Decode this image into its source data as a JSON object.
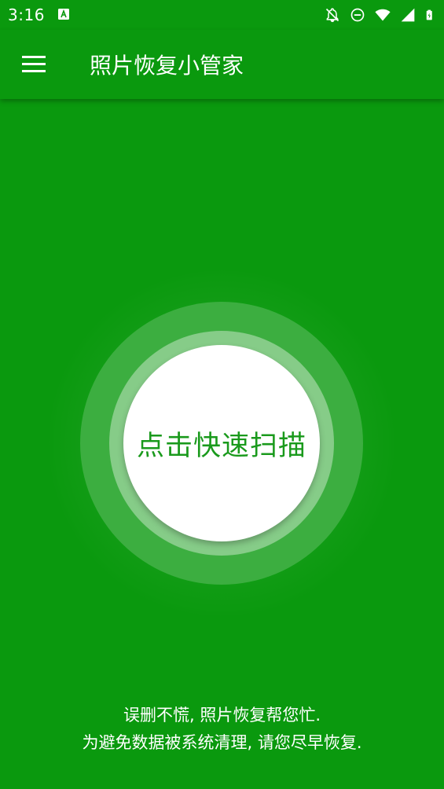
{
  "status_bar": {
    "time": "3:16",
    "icons": [
      "app-a-icon",
      "notifications-off-icon",
      "do-not-disturb-icon",
      "wifi-icon",
      "signal-icon",
      "battery-charging-icon"
    ]
  },
  "app_bar": {
    "title": "照片恢复小管家",
    "menu_icon": "menu-icon"
  },
  "scan": {
    "button_label": "点击快速扫描"
  },
  "tips": {
    "line1": "误删不慌, 照片恢复帮您忙.",
    "line2": "为避免数据被系统清理, 请您尽早恢复."
  },
  "colors": {
    "primary": "#0a990e",
    "outer_ring": "#3cae40",
    "inner_ring": "#86cc88",
    "button_text": "#1a9a1c"
  }
}
